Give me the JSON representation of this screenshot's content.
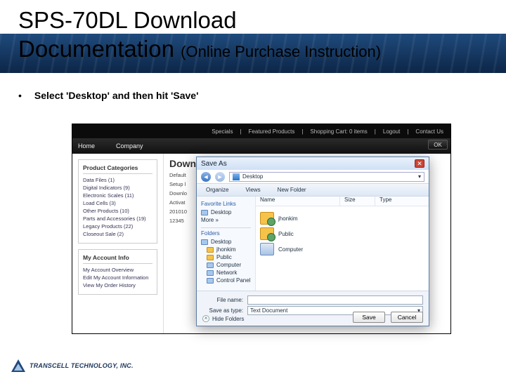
{
  "header": {
    "line1": "SPS-70DL Download",
    "line2_main": "Documentation",
    "line2_paren": "(Online Purchase Instruction)"
  },
  "bullet": {
    "marker": "•",
    "text": "Select 'Desktop' and then hit 'Save'"
  },
  "site": {
    "top_links": [
      "Specials",
      "Featured Products",
      "Shopping Cart: 0 items",
      "Logout",
      "Contact Us"
    ],
    "nav": [
      "Home",
      "Company"
    ],
    "ok": "OK",
    "categories_title": "Product Categories",
    "categories": [
      "Data Files (1)",
      "Digital Indicators (9)",
      "Electronic Scales (11)",
      "Load Cells (3)",
      "Other Products (10)",
      "Parts and Accessories (19)",
      "Legacy Products (22)",
      "Closeout Sale (2)"
    ],
    "account_title": "My Account Info",
    "account_items": [
      "My Account Overview",
      "Edit My Account Information",
      "View My Order History"
    ],
    "center_title": "Down",
    "center_lines": [
      "Default",
      "Setup l",
      "Downlo",
      "Activat",
      "201010",
      "12345"
    ]
  },
  "dialog": {
    "title": "Save As",
    "crumb": "Desktop",
    "toolbar": {
      "organize": "Organize",
      "views": "Views",
      "newfolder": "New Folder"
    },
    "left": {
      "fav": "Favorite Links",
      "desktop": "Desktop",
      "more": "More »",
      "folders": "Folders",
      "items": [
        "Desktop",
        "jhonkim",
        "Public",
        "Computer",
        "Network",
        "Control Panel"
      ]
    },
    "cols": {
      "name": "Name",
      "size": "Size",
      "type": "Type"
    },
    "rows": [
      "jhonkim",
      "Public",
      "Computer"
    ],
    "filename_label": "File name:",
    "savetype_label": "Save as type:",
    "savetype_value": "Text Document",
    "hide": "Hide Folders",
    "save": "Save",
    "cancel": "Cancel"
  },
  "footer": {
    "brand": "TRANSCELL TECHNOLOGY, INC."
  }
}
